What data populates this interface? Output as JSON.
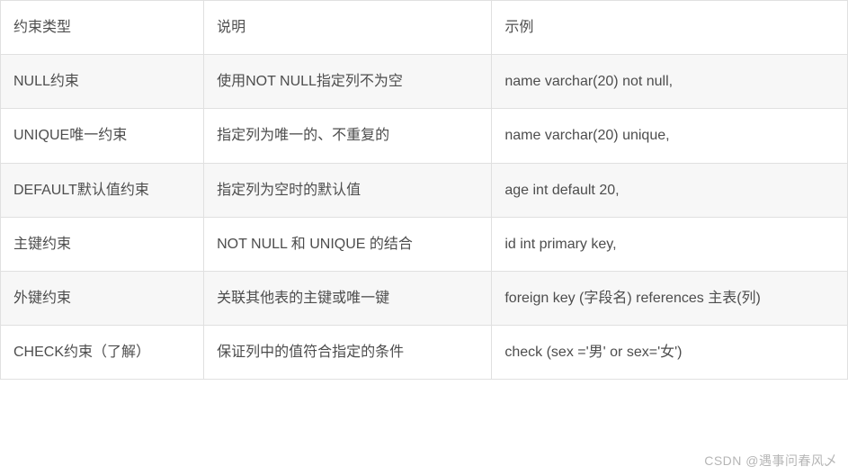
{
  "table": {
    "headers": [
      "约束类型",
      "说明",
      "示例"
    ],
    "rows": [
      {
        "type": "NULL约束",
        "desc": "使用NOT NULL指定列不为空",
        "example": "name varchar(20) not null,"
      },
      {
        "type": "UNIQUE唯一约束",
        "desc": "指定列为唯一的、不重复的",
        "example": "name varchar(20) unique,"
      },
      {
        "type": "DEFAULT默认值约束",
        "desc": "指定列为空时的默认值",
        "example": "age int default 20,"
      },
      {
        "type": "主键约束",
        "desc": "NOT NULL 和 UNIQUE 的结合",
        "example": "id int primary key,"
      },
      {
        "type": "外键约束",
        "desc": "关联其他表的主键或唯一键",
        "example": "foreign key (字段名) references 主表(列)"
      },
      {
        "type": "CHECK约束（了解）",
        "desc": "保证列中的值符合指定的条件",
        "example": "check (sex ='男' or sex='女')"
      }
    ]
  },
  "watermark": "CSDN @遇事问春风乄"
}
